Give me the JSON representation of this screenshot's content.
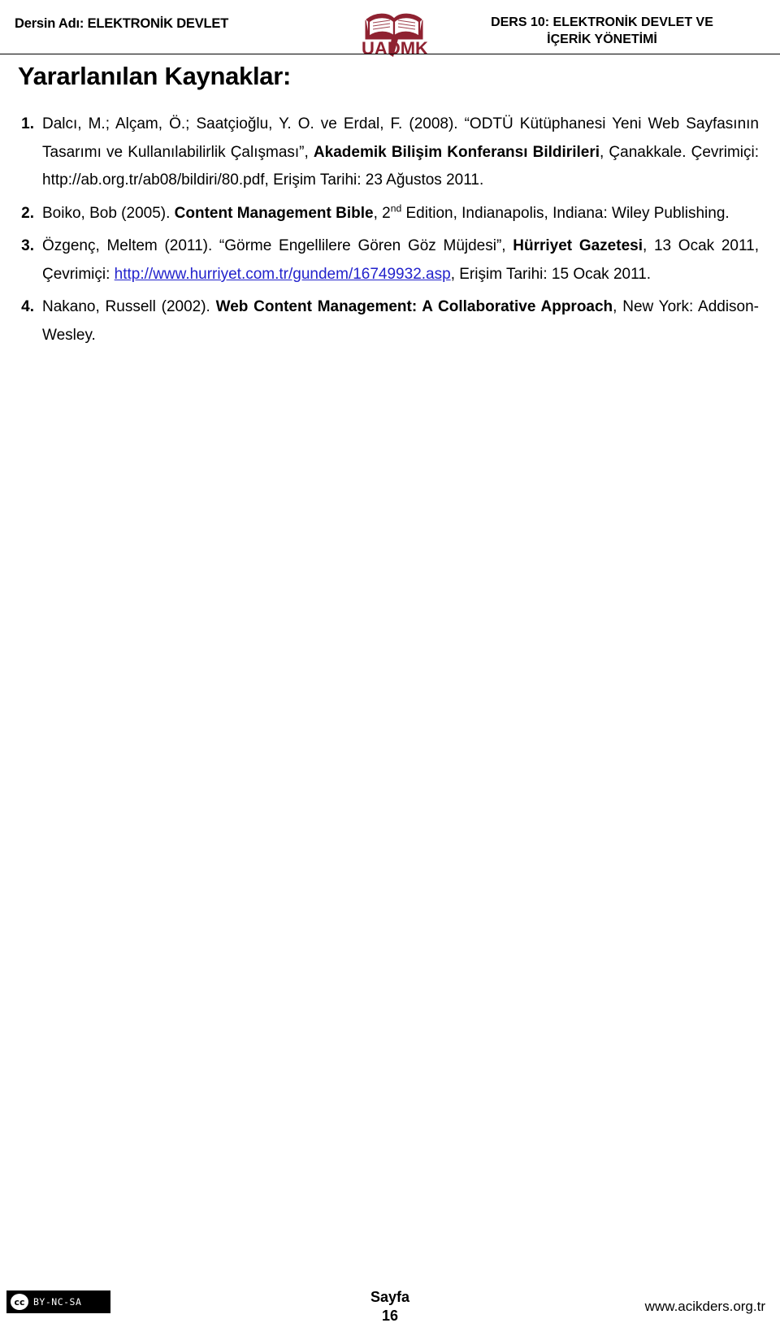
{
  "header": {
    "course_label": "Dersin Adı: ELEKTRONİK DEVLET",
    "lesson_title_line1": "DERS 10: ELEKTRONİK DEVLET VE",
    "lesson_title_line2": "İÇERİK YÖNETİMİ",
    "logo_text": "UADMK",
    "logo_color": "#8f2231"
  },
  "title": "Yararlanılan Kaynaklar:",
  "references": [
    {
      "number": "1.",
      "segments": [
        {
          "text": "Dalcı, M.; Alçam, Ö.; Saatçioğlu, Y. O. ve Erdal, F. (2008). “ODTÜ Kütüphanesi Yeni Web Sayfasının Tasarımı ve Kullanılabilirlik Çalışması”, ",
          "style": "normal"
        },
        {
          "text": "Akademik Bilişim Konferansı Bildirileri",
          "style": "bold"
        },
        {
          "text": ", Çanakkale. Çevrimiçi: http://ab.org.tr/ab08/bildiri/80.pdf, Erişim Tarihi: 23 Ağustos 2011.",
          "style": "normal"
        }
      ]
    },
    {
      "number": "2.",
      "segments": [
        {
          "text": "Boiko, Bob (2005). ",
          "style": "normal"
        },
        {
          "text": "Content Management Bible",
          "style": "bold"
        },
        {
          "text": ", 2",
          "style": "normal"
        },
        {
          "text": "nd",
          "style": "superscript"
        },
        {
          "text": " Edition, Indianapolis, Indiana: Wiley Publishing.",
          "style": "normal"
        }
      ]
    },
    {
      "number": "3.",
      "segments": [
        {
          "text": "Özgenç, Meltem (2011). “Görme Engellilere Gören Göz Müjdesi”, ",
          "style": "normal"
        },
        {
          "text": "Hürriyet Gazetesi",
          "style": "bold"
        },
        {
          "text": ", 13 Ocak 2011, Çevrimiçi: ",
          "style": "normal"
        },
        {
          "text": "http://www.hurriyet.com.tr/gundem/16749932.asp",
          "style": "link"
        },
        {
          "text": ", Erişim Tarihi: 15 Ocak 2011.",
          "style": "normal"
        }
      ]
    },
    {
      "number": "4.",
      "segments": [
        {
          "text": "Nakano, Russell (2002). ",
          "style": "normal"
        },
        {
          "text": "Web Content Management: A Collaborative Approach",
          "style": "bold"
        },
        {
          "text": ", New York: Addison-Wesley.",
          "style": "normal"
        }
      ]
    }
  ],
  "footer": {
    "license_mark": "cc",
    "license_terms": "BY-NC-SA",
    "page_label": "Sayfa",
    "page_number": "16",
    "website": "www.acikders.org.tr"
  }
}
